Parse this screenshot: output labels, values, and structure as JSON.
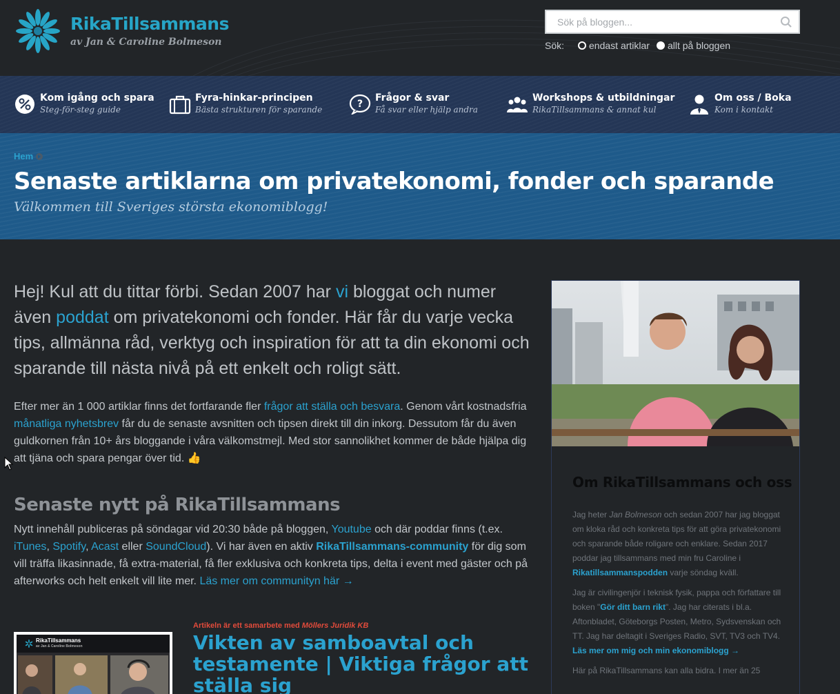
{
  "brand": {
    "title": "RikaTillsammans",
    "subtitle": "av Jan & Caroline Bolmeson"
  },
  "search": {
    "placeholder": "Sök på bloggen...",
    "label": "Sök:",
    "option_articles": "endast artiklar",
    "option_all": "allt på bloggen"
  },
  "nav": {
    "items": [
      {
        "title": "Kom igång och spara",
        "sub": "Steg-för-steg guide"
      },
      {
        "title": "Fyra-hinkar-principen",
        "sub": "Bästa strukturen för sparande"
      },
      {
        "title": "Frågor & svar",
        "sub": "Få svar eller hjälp andra"
      },
      {
        "title": "Workshops & utbildningar",
        "sub": "RikaTillsammans & annat kul"
      },
      {
        "title": "Om oss / Boka",
        "sub": "Kom i kontakt"
      }
    ]
  },
  "hero": {
    "breadcrumb": "Hem",
    "title": "Senaste artiklarna om privatekonomi, fonder och sparande",
    "subtitle": "Välkommen till Sveriges största ekonomiblogg!"
  },
  "intro": {
    "p1": "Hej! Kul att du tittar förbi. Sedan 2007 har ",
    "link_vi": "vi",
    "p2": " bloggat och numer även ",
    "link_poddat": "poddat",
    "p3": " om privatekonomi och fonder. Här får du varje vecka tips, allmänna råd, verktyg och inspiration för att ta din ekonomi och sparande till nästa nivå på ett enkelt och roligt sätt."
  },
  "para1": {
    "t1": "Efter mer än 1 000 artiklar finns det fortfarande fler ",
    "link1": "frågor att ställa och besvara",
    "t2": ". Genom vårt kostnadsfria ",
    "link2": "månatliga nyhetsbrev",
    "t3": " får du de senaste avsnitten och tipsen direkt till din inkorg. Dessutom får du även guldkornen från 10+ års bloggande i våra välkomstmejl. Med stor sannolikhet kommer de både hjälpa dig att tjäna och spara pengar över tid. 👍"
  },
  "news": {
    "heading": "Senaste nytt på RikaTillsammans",
    "t1": "Nytt innehåll publiceras på söndagar vid 20:30 både på bloggen, ",
    "youtube": "Youtube",
    "t2": " och där poddar finns (t.ex. ",
    "itunes": "iTunes",
    "c1": ", ",
    "spotify": "Spotify",
    "c2": ", ",
    "acast": "Acast",
    "t3": " eller ",
    "soundcloud": "SoundCloud",
    "t4": "). Vi har även en aktiv ",
    "community": "RikaTillsammans-community",
    "t5": " för dig som vill träffa likasinnade, få extra-material, få fler exklusiva och konkreta tips, delta i event med gäster och på afterworks och helt enkelt vill lite mer. ",
    "readmore": "Läs mer om communityn här →"
  },
  "article": {
    "collab_prefix": "Artikeln är ett samarbete med ",
    "collab_partner": "Möllers Juridik KB",
    "title": "Vikten av samboavtal och testamente | Viktiga frågor att ställa sig",
    "thumb_logo": "RikaTillsammans",
    "thumb_sub": "av Jan & Caroline Bolmeson"
  },
  "sidebar": {
    "title": "Om RikaTillsammans och oss",
    "p1_a": "Jag heter ",
    "p1_name": "Jan Bolmeson",
    "p1_b": " och sedan 2007 har jag bloggat om kloka råd och konkreta tips för att göra privatekonomi och sparande både roligare och enklare. Sedan 2017 poddar jag tillsammans med min fru Caroline i ",
    "p1_link": "Rikatillsammanspodden",
    "p1_c": " varje söndag kväll.",
    "p2_a": "Jag är civilingenjör i teknisk fysik, pappa och författare till boken \"",
    "p2_book": "Gör ditt barn rikt",
    "p2_b": "\". Jag har citerats i bl.a. Aftonbladet, Göteborgs Posten, Metro, Sydsvenskan och TT. Jag har deltagit i Sveriges Radio, SVT, TV3 och TV4. ",
    "p2_link": "Läs mer om mig och min ekonomiblogg →",
    "p3": "Här på RikaTillsammans kan alla bidra. I mer än 25"
  },
  "colors": {
    "accent": "#2ba2cf",
    "nav_bg": "#243656",
    "hero_bg": "#1e5a8a",
    "page_bg": "#222528",
    "collab_red": "#e24b3b"
  }
}
